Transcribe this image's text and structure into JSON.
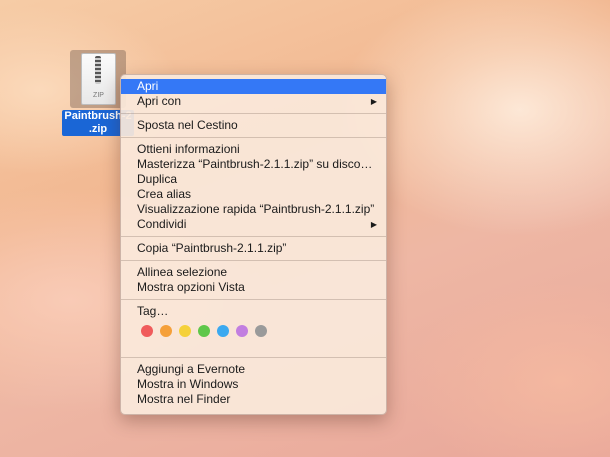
{
  "file": {
    "label_line1": "Paintbrush-2",
    "label_line2": ".zip",
    "icon_text": "ZIP",
    "icon": "zip-archive-icon"
  },
  "menu": {
    "open": "Apri",
    "open_with": "Apri con",
    "move_to_trash": "Sposta nel Cestino",
    "get_info": "Ottieni informazioni",
    "burn": "Masterizza “Paintbrush-2.1.1.zip” su disco…",
    "duplicate": "Duplica",
    "make_alias": "Crea alias",
    "quick_look": "Visualizzazione rapida “Paintbrush-2.1.1.zip”",
    "share": "Condividi",
    "copy": "Copia “Paintbrush-2.1.1.zip”",
    "clean_up": "Allinea selezione",
    "view_options": "Mostra opzioni Vista",
    "tags": "Tag…",
    "add_evernote": "Aggiungi a Evernote",
    "show_windows": "Mostra in Windows",
    "show_finder": "Mostra nel Finder",
    "submenu_arrow": "▶"
  },
  "tag_colors": [
    "#f05b5b",
    "#f5a03a",
    "#f5d13a",
    "#5fc74a",
    "#3ba9f0",
    "#c27ee0",
    "#9a9a9a"
  ],
  "colors": {
    "selection": "#3478f6",
    "file_label": "#1a66d6"
  }
}
